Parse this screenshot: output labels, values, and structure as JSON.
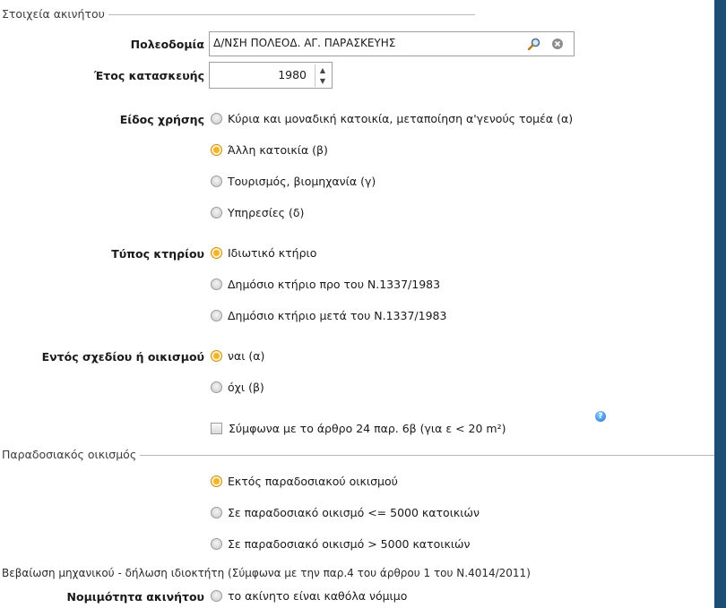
{
  "property": {
    "section_title": "Στοιχεία ακινήτου",
    "town_planning_label": "Πολεοδομία",
    "town_planning_value": "Δ/ΝΣΗ ΠΟΛΕΟΔ. ΑΓ. ΠΑΡΑΣΚΕΥΗΣ",
    "year_label": "Έτος κατασκευής",
    "year_value": "1980",
    "use_label": "Είδος χρήσης",
    "use_options": [
      "Κύρια και μοναδική κατοικία, μεταποίηση α'γενούς τομέα (α)",
      "Άλλη κατοικία (β)",
      "Τουρισμός, βιομηχανία (γ)",
      "Υπηρεσίες (δ)"
    ],
    "use_selected": 1,
    "building_type_label": "Τύπος κτηρίου",
    "building_type_options": [
      "Ιδιωτικό κτήριο",
      "Δημόσιο κτήριο προ του Ν.1337/1983",
      "Δημόσιο κτήριο μετά του Ν.1337/1983"
    ],
    "building_type_selected": 0,
    "plan_label": "Εντός σχεδίου ή οικισμού",
    "plan_options": [
      "ναι (α)",
      "όχι (β)"
    ],
    "plan_selected": 0,
    "article_checkbox_label": "Σύμφωνα με το άρθρο 24 παρ. 6β (για ε < 20 m²)",
    "article_checked": false
  },
  "traditional": {
    "section_title": "Παραδοσιακός οικισμός",
    "options": [
      "Εκτός παραδοσιακού οικισμού",
      "Σε παραδοσιακό οικισμό <= 5000 κατοικιών",
      "Σε παραδοσιακό οικισμό > 5000 κατοικιών"
    ],
    "selected": 0
  },
  "declaration": {
    "title": "Βεβαίωση μηχανικού - δήλωση ιδιοκτήτη (Σύμφωνα με την παρ.4 του άρθρου 1 του Ν.4014/2011)",
    "legality_label": "Νομιμότητα ακινήτου",
    "legality_option": "το ακίνητο είναι καθόλα νόμιμο"
  },
  "colors": {
    "selected_radio": "#f6b324",
    "window_frame": "#1d4e76"
  }
}
